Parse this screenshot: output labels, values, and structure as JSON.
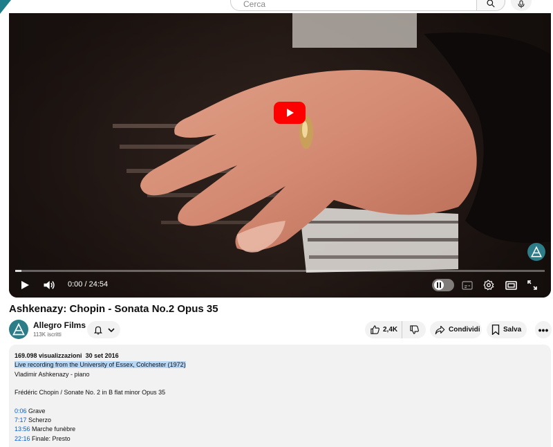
{
  "search": {
    "placeholder": "Cerca",
    "search_icon": "search-icon",
    "mic_icon": "microphone-icon"
  },
  "player": {
    "current_time": "0:00",
    "duration": "24:54",
    "time_display": "0:00 / 24:54",
    "progress_fraction": 0,
    "icons": [
      "youtube-play-icon",
      "play-icon",
      "volume-icon",
      "autoplay-toggle",
      "subtitles-icon",
      "settings-icon",
      "theater-icon",
      "fullscreen-icon",
      "channel-watermark-icon"
    ]
  },
  "video": {
    "title": "Ashkenazy: Chopin - Sonata No.2 Opus 35"
  },
  "channel": {
    "name": "Allegro Films",
    "subscribers": "113K iscritti"
  },
  "actions": {
    "likes": "2,4K",
    "share_label": "Condividi",
    "save_label": "Salva",
    "more_label": "•••"
  },
  "description": {
    "views": "169.098 visualizzazioni",
    "date": "30 set 2016",
    "highlight_line": "Live recording from the University of Essex, Colchester  (1972)",
    "performer": "Vladimir Ashkenazy - piano",
    "piece": "Frédéric Chopin / Sonate No. 2 in B flat minor Opus 35",
    "chapters": [
      {
        "time": "0:06",
        "name": "Grave"
      },
      {
        "time": "7:17",
        "name": "Scherzo"
      },
      {
        "time": "13:56",
        "name": "Marche funèbre"
      },
      {
        "time": "22:16",
        "name": "Finale: Presto"
      }
    ]
  },
  "colors": {
    "accent_red": "#ff0000",
    "link_blue": "#065fd4",
    "highlight": "#b8d7f5",
    "channel_teal": "#2c7d88"
  }
}
